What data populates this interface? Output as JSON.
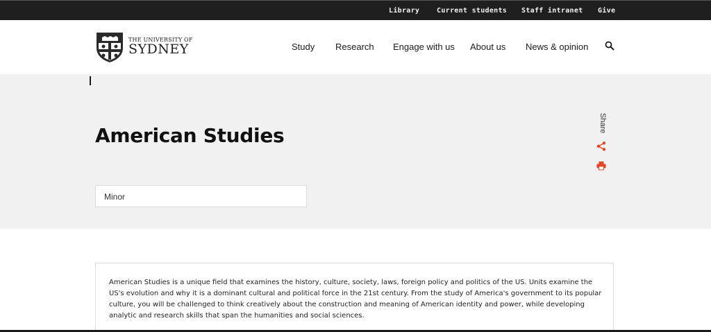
{
  "utility_nav": {
    "items": [
      {
        "label": "Library"
      },
      {
        "label": "Current students"
      },
      {
        "label": "Staff intranet"
      },
      {
        "label": "Give"
      }
    ]
  },
  "logo": {
    "line1": "THE UNIVERSITY OF",
    "line2": "SYDNEY"
  },
  "main_nav": {
    "items": [
      {
        "label": "Study"
      },
      {
        "label": "Research"
      },
      {
        "label": "Engage with us"
      },
      {
        "label": "About us"
      },
      {
        "label": "News & opinion"
      }
    ]
  },
  "hero": {
    "title": "American Studies",
    "type_label": "Minor",
    "share_label": "Share"
  },
  "content": {
    "description": "American Studies is a unique field that examines the history, culture, society, laws, foreign policy and politics of the US. Units examine the US's evolution and why it is a dominant cultural and political force in the 21st century. From the study of America's government to its popular culture, you will be challenged to think creatively about the construction and meaning of American identity and power, while developing analytic and research skills that span the humanities and social sciences."
  },
  "colors": {
    "accent": "#e64626",
    "top_bar": "#1f1f1f",
    "hero_bg": "#f1f1f1"
  }
}
